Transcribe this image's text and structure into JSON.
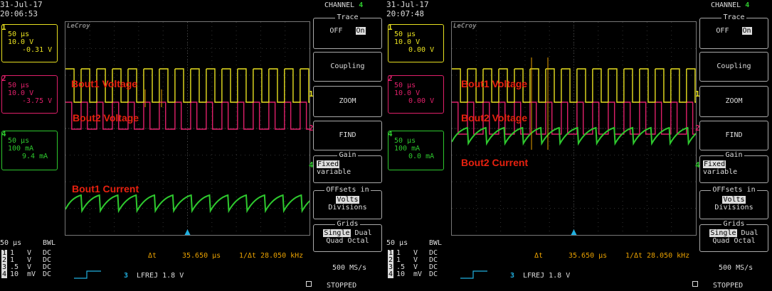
{
  "colors": {
    "ch1": "#e8e020",
    "ch2": "#e0206a",
    "ch4": "#2ec82e",
    "accent": "#e8a000",
    "trigger": "#20b0e0",
    "annotation": "#e8210f"
  },
  "panels": [
    {
      "date": "31-Jul-17",
      "time": "20:06:53",
      "channel_title": "CHANNEL",
      "channel_num": "4",
      "brand": "LeCroy",
      "ch1": {
        "num": "1",
        "time": "50 µs",
        "volt": "10.0 V",
        "offset": "-0.31 V"
      },
      "ch2": {
        "num": "2",
        "time": "50 µs",
        "volt": "10.0 V",
        "offset": "-3.75 V"
      },
      "ch4": {
        "num": "4",
        "time": "50 µs",
        "volt": "100 mA",
        "offset": "9.4 mA"
      },
      "annotations": [
        "Bout1 Voltage",
        "Bout2 Voltage",
        "Bout1 Current"
      ],
      "trace": {
        "caption": "Trace",
        "off": "OFF",
        "on": "On"
      },
      "coupling": "Coupling",
      "zoom": "ZOOM",
      "find": "FIND",
      "gain": {
        "caption": "Gain",
        "fixed": "Fixed",
        "variable": "variable"
      },
      "offsets": {
        "caption": "OFFsets in",
        "volts": "Volts",
        "divisions": "Divisions"
      },
      "grids": {
        "caption": "Grids",
        "single": "Single",
        "dual": "Dual",
        "quad": "Quad",
        "octal": "Octal"
      },
      "timebase": "50 µs",
      "bwl": "BWL",
      "ch_rows": [
        [
          "1",
          "1",
          "V",
          "DC"
        ],
        [
          "2",
          "1",
          "V",
          "DC"
        ],
        [
          "3",
          ".5",
          "V",
          "DC"
        ],
        [
          "4",
          "10",
          "mV",
          "DC"
        ]
      ],
      "delta_label": "Δt",
      "delta_value": "35.650 µs",
      "freq_label": "1/Δt",
      "freq_value": "28.050 kHz",
      "trigger_ch": "3",
      "trigger_text": "LFREJ 1.8 V",
      "sample_rate": "500 MS/s",
      "status": "STOPPED"
    },
    {
      "date": "31-Jul-17",
      "time": "20:07:48",
      "channel_title": "CHANNEL",
      "channel_num": "4",
      "brand": "LeCroy",
      "ch1": {
        "num": "1",
        "time": "50 µs",
        "volt": "10.0 V",
        "offset": "0.00 V"
      },
      "ch2": {
        "num": "2",
        "time": "50 µs",
        "volt": "10.0 V",
        "offset": "0.00 V"
      },
      "ch4": {
        "num": "4",
        "time": "50 µs",
        "volt": "100 mA",
        "offset": "0.0 mA"
      },
      "annotations": [
        "Bout1 Voltage",
        "Bout2 Voltage",
        "Bout2 Current"
      ],
      "trace": {
        "caption": "Trace",
        "off": "OFF",
        "on": "On"
      },
      "coupling": "Coupling",
      "zoom": "ZOOM",
      "find": "FIND",
      "gain": {
        "caption": "Gain",
        "fixed": "Fixed",
        "variable": "variable"
      },
      "offsets": {
        "caption": "OFFsets in",
        "volts": "Volts",
        "divisions": "Divisions"
      },
      "grids": {
        "caption": "Grids",
        "single": "Single",
        "dual": "Dual",
        "quad": "Quad",
        "octal": "Octal"
      },
      "timebase": "50 µs",
      "bwl": "BWL",
      "ch_rows": [
        [
          "1",
          "1",
          "V",
          "DC"
        ],
        [
          "2",
          "1",
          "V",
          "DC"
        ],
        [
          "3",
          ".5",
          "V",
          "DC"
        ],
        [
          "4",
          "10",
          "mV",
          "DC"
        ]
      ],
      "delta_label": "Δt",
      "delta_value": "35.650 µs",
      "freq_label": "1/Δt",
      "freq_value": "28.050 kHz",
      "trigger_ch": "3",
      "trigger_text": "LFREJ 1.8 V",
      "sample_rate": "500 MS/s",
      "status": "STOPPED"
    }
  ]
}
